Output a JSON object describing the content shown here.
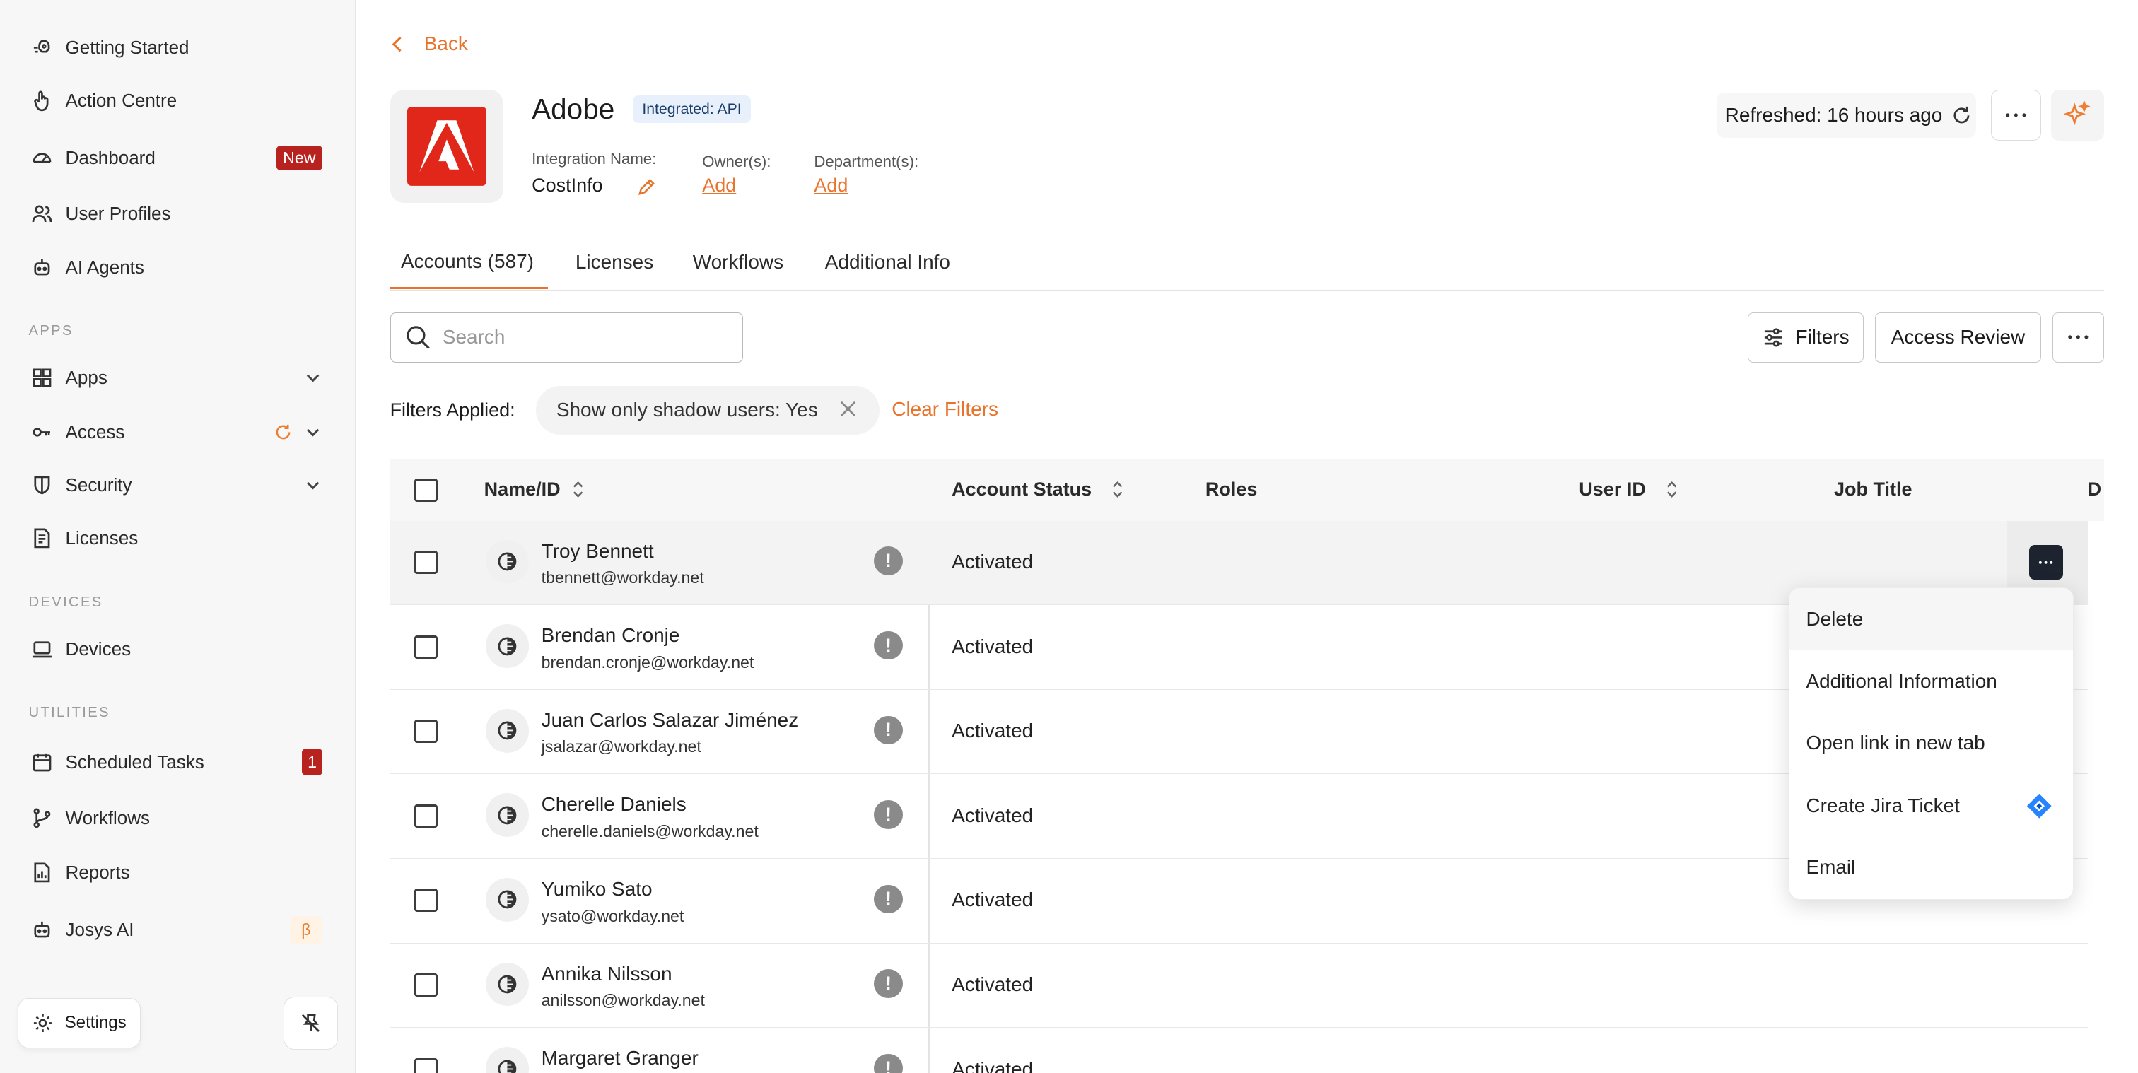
{
  "sidebar": {
    "items_top": [
      {
        "label": "Getting Started",
        "icon": "rocket-icon"
      },
      {
        "label": "Action Centre",
        "icon": "hand-icon"
      },
      {
        "label": "Dashboard",
        "icon": "gauge-icon",
        "badge": "New"
      },
      {
        "label": "User Profiles",
        "icon": "users-icon"
      },
      {
        "label": "AI Agents",
        "icon": "robot-icon"
      }
    ],
    "apps_header": "APPS",
    "apps_items": [
      {
        "label": "Apps",
        "icon": "grid-icon"
      },
      {
        "label": "Access",
        "icon": "key-icon"
      },
      {
        "label": "Security",
        "icon": "shield-icon"
      },
      {
        "label": "Licenses",
        "icon": "document-icon"
      }
    ],
    "devices_header": "DEVICES",
    "devices_items": [
      {
        "label": "Devices",
        "icon": "laptop-icon"
      }
    ],
    "utilities_header": "UTILITIES",
    "utilities_items": [
      {
        "label": "Scheduled Tasks",
        "icon": "calendar-icon",
        "badge": "1"
      },
      {
        "label": "Workflows",
        "icon": "branch-icon"
      },
      {
        "label": "Reports",
        "icon": "report-icon"
      },
      {
        "label": "Josys AI",
        "icon": "robot-icon",
        "badge": "β"
      }
    ],
    "settings_label": "Settings"
  },
  "header": {
    "back_label": "Back",
    "app_name": "Adobe",
    "integration_badge": "Integrated: API",
    "integration_name_label": "Integration Name:",
    "integration_name_value": "CostInfo",
    "owners_label": "Owner(s):",
    "owners_value": "Add",
    "department_label": "Department(s):",
    "department_value": "Add",
    "refreshed": "Refreshed: 16 hours ago"
  },
  "tabs": [
    "Accounts (587)",
    "Licenses",
    "Workflows",
    "Additional Info"
  ],
  "toolbar": {
    "search_placeholder": "Search",
    "filters_label": "Filters",
    "access_review_label": "Access Review"
  },
  "filters": {
    "applied_label": "Filters Applied:",
    "chip": "Show only shadow users: Yes",
    "clear_label": "Clear Filters"
  },
  "table": {
    "columns": [
      "Name/ID",
      "Account Status",
      "Roles",
      "User ID",
      "Job Title",
      "D"
    ],
    "rows": [
      {
        "name": "Troy Bennett",
        "email": "tbennett@workday.net",
        "status": "Activated"
      },
      {
        "name": "Brendan Cronje",
        "email": "brendan.cronje@workday.net",
        "status": "Activated"
      },
      {
        "name": "Juan Carlos Salazar Jiménez",
        "email": "jsalazar@workday.net",
        "status": "Activated"
      },
      {
        "name": "Cherelle Daniels",
        "email": "cherelle.daniels@workday.net",
        "status": "Activated"
      },
      {
        "name": "Yumiko Sato",
        "email": "ysato@workday.net",
        "status": "Activated"
      },
      {
        "name": "Annika Nilsson",
        "email": "anilsson@workday.net",
        "status": "Activated"
      },
      {
        "name": "Margaret Granger",
        "email": "",
        "status": "Activated"
      }
    ],
    "warn_glyph": "!"
  },
  "row_menu": {
    "items": [
      "Delete",
      "Additional Information",
      "Open link in new tab",
      "Create Jira Ticket",
      "Email"
    ]
  },
  "colors": {
    "accent": "#e8732c",
    "badge_red": "#b8231f",
    "adobe_red": "#e0271a"
  }
}
